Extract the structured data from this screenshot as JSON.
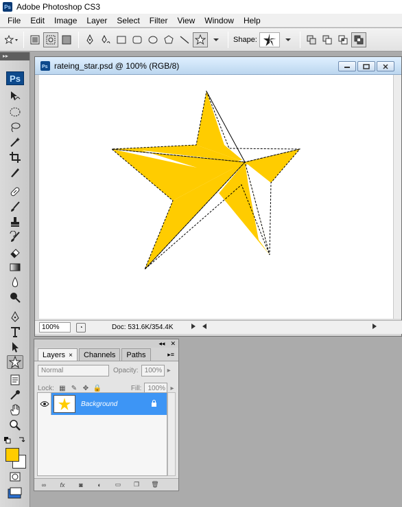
{
  "app": {
    "title": "Adobe Photoshop CS3",
    "logo_text": "Ps"
  },
  "menu": [
    "File",
    "Edit",
    "Image",
    "Layer",
    "Select",
    "Filter",
    "View",
    "Window",
    "Help"
  ],
  "options_bar": {
    "shape_label": "Shape:"
  },
  "toolbox": {
    "header": "▸▸",
    "logo": "Ps",
    "foreground_color": "#ffcc00",
    "background_color": "#ffffff",
    "tools": [
      "move-tool",
      "marquee-tool",
      "lasso-tool",
      "magic-wand-tool",
      "crop-tool",
      "slice-tool",
      "healing-brush-tool",
      "brush-tool",
      "clone-stamp-tool",
      "history-brush-tool",
      "eraser-tool",
      "gradient-tool",
      "blur-tool",
      "dodge-tool",
      "pen-tool",
      "type-tool",
      "path-selection-tool",
      "custom-shape-tool",
      "notes-tool",
      "eyedropper-tool",
      "hand-tool",
      "zoom-tool"
    ]
  },
  "document": {
    "title": "rateing_star.psd @ 100% (RGB/8)",
    "zoom": "100%",
    "doc_info": "Doc: 531.6K/354.4K",
    "star_color": "#ffcc00"
  },
  "layers_panel": {
    "tabs": [
      "Layers",
      "Channels",
      "Paths"
    ],
    "tab_close": "×",
    "blend_mode": "Normal",
    "opacity_label": "Opacity:",
    "opacity_value": "100%",
    "lock_label": "Lock:",
    "fill_label": "Fill:",
    "fill_value": "100%",
    "layer": {
      "name": "Background",
      "visible": true,
      "locked": true
    }
  },
  "colors": {
    "selection_blue": "#3d95f5",
    "accent_yellow": "#ffcc00"
  }
}
